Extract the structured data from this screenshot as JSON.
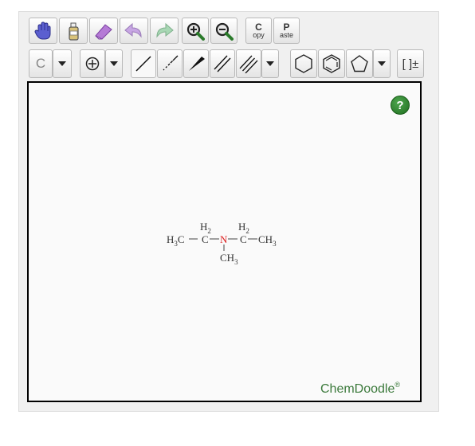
{
  "toolbar": {
    "row1": {
      "copy": {
        "big": "C",
        "small": "opy"
      },
      "paste": {
        "big": "P",
        "small": "aste"
      }
    },
    "row2": {
      "element_label": "C",
      "charge_label": "[ ]±"
    }
  },
  "canvas": {
    "molecule": {
      "left_group": {
        "main": "H",
        "sub": "3",
        "tail": "C"
      },
      "ch2_left": {
        "top": "H",
        "top_sub": "2",
        "atom": "C"
      },
      "nitrogen": "N",
      "ch2_right": {
        "top": "H",
        "top_sub": "2",
        "atom": "C"
      },
      "right_group": {
        "main": "CH",
        "sub": "3"
      },
      "methyl": {
        "main": "CH",
        "sub": "3"
      }
    },
    "help_label": "?",
    "brand": {
      "name": "ChemDoodle",
      "mark": "®"
    }
  },
  "colors": {
    "nitrogen": "#d22",
    "bond": "#444",
    "brand": "#3c7a3c"
  }
}
